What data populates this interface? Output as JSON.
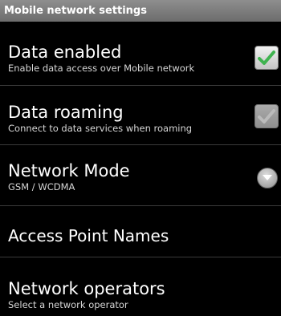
{
  "header": {
    "title": "Mobile network settings"
  },
  "settings": [
    {
      "title": "Data enabled",
      "summary": "Enable data access over Mobile network",
      "control": "checkbox",
      "checked": true,
      "enabled": true
    },
    {
      "title": "Data roaming",
      "summary": "Connect to data services when roaming",
      "control": "checkbox",
      "checked": true,
      "enabled": false
    },
    {
      "title": "Network Mode",
      "summary": "GSM / WCDMA",
      "control": "dropdown"
    },
    {
      "title": "Access Point Names"
    },
    {
      "title": "Network operators",
      "summary": "Select a network operator"
    }
  ],
  "colors": {
    "check_on": "#3fb34f",
    "check_disabled": "#dcdcdc",
    "divider": "#3a3a3a"
  }
}
